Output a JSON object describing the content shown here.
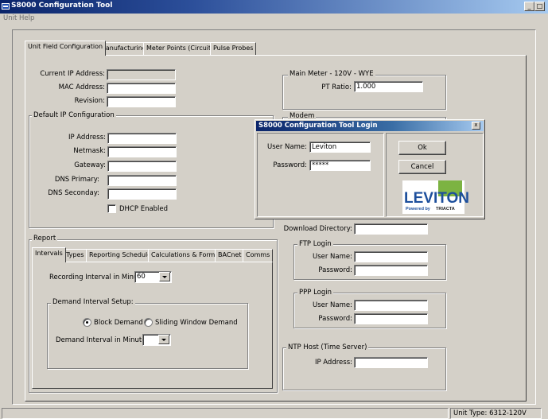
{
  "window": {
    "title": "S8000 Configuration Tool",
    "minimize": "_",
    "maximize": "□"
  },
  "menu": {
    "items": [
      "Unit",
      "Help"
    ]
  },
  "main_tabs": [
    "Unit Field Configuration",
    "Manufacturing",
    "Meter Points (Circuits)",
    "Pulse Probes"
  ],
  "unit": {
    "current_ip_label": "Current IP Address:",
    "current_ip_value": "",
    "mac_label": "MAC Address:",
    "mac_value": "",
    "revision_label": "Revision:",
    "revision_value": ""
  },
  "default_ip": {
    "group_label": "Default IP Configuration",
    "ip_label": "IP Address:",
    "netmask_label": "Netmask:",
    "gateway_label": "Gateway:",
    "dns_primary_label": "DNS Primary:",
    "dns_secondary_label": "DNS Seconday:",
    "dhcp_label": "DHCP Enabled"
  },
  "main_meter": {
    "group_label": "Main Meter - 120V - WYE",
    "pt_ratio_label": "PT Ratio:",
    "pt_ratio_value": "1.000"
  },
  "modem": {
    "group_label": "Modem"
  },
  "download": {
    "label": "Download Directory:"
  },
  "ftp": {
    "group_label": "FTP Login",
    "user_label": "User Name:",
    "password_label": "Password:"
  },
  "ppp": {
    "group_label": "PPP Login",
    "user_label": "User Name:",
    "password_label": "Password:"
  },
  "ntp": {
    "group_label": "NTP Host (Time Server)",
    "ip_label": "IP Address:"
  },
  "report": {
    "group_label": "Report",
    "tabs": [
      "Intervals",
      "Types",
      "Reporting Schedule",
      "Calculations & Format",
      "BACnet",
      "Comms"
    ],
    "recording_label": "Recording Interval in Minutes:",
    "recording_value": "60",
    "demand_group_label": "Demand Interval Setup:",
    "block_label": "Block Demand",
    "sliding_label": "Sliding Window Demand",
    "demand_minutes_label": "Demand Interval in Minutes:",
    "demand_minutes_value": ""
  },
  "login": {
    "title": "S8000 Configuration Tool Login",
    "close": "x",
    "user_label": "User Name:",
    "user_value": "Leviton",
    "password_label": "Password:",
    "password_value": "*****",
    "ok_label": "Ok",
    "cancel_label": "Cancel",
    "logo_text": "LEVITON",
    "logo_sub": "Powered by",
    "logo_partner": "TRIACTA"
  },
  "status": {
    "unit_type": "Unit Type: 6312-120V"
  },
  "colors": {
    "title_start": "#0a246a",
    "title_end": "#a6caf0",
    "face": "#d4d0c8",
    "logo_blue": "#1d4f9c",
    "logo_green": "#7cb342"
  }
}
